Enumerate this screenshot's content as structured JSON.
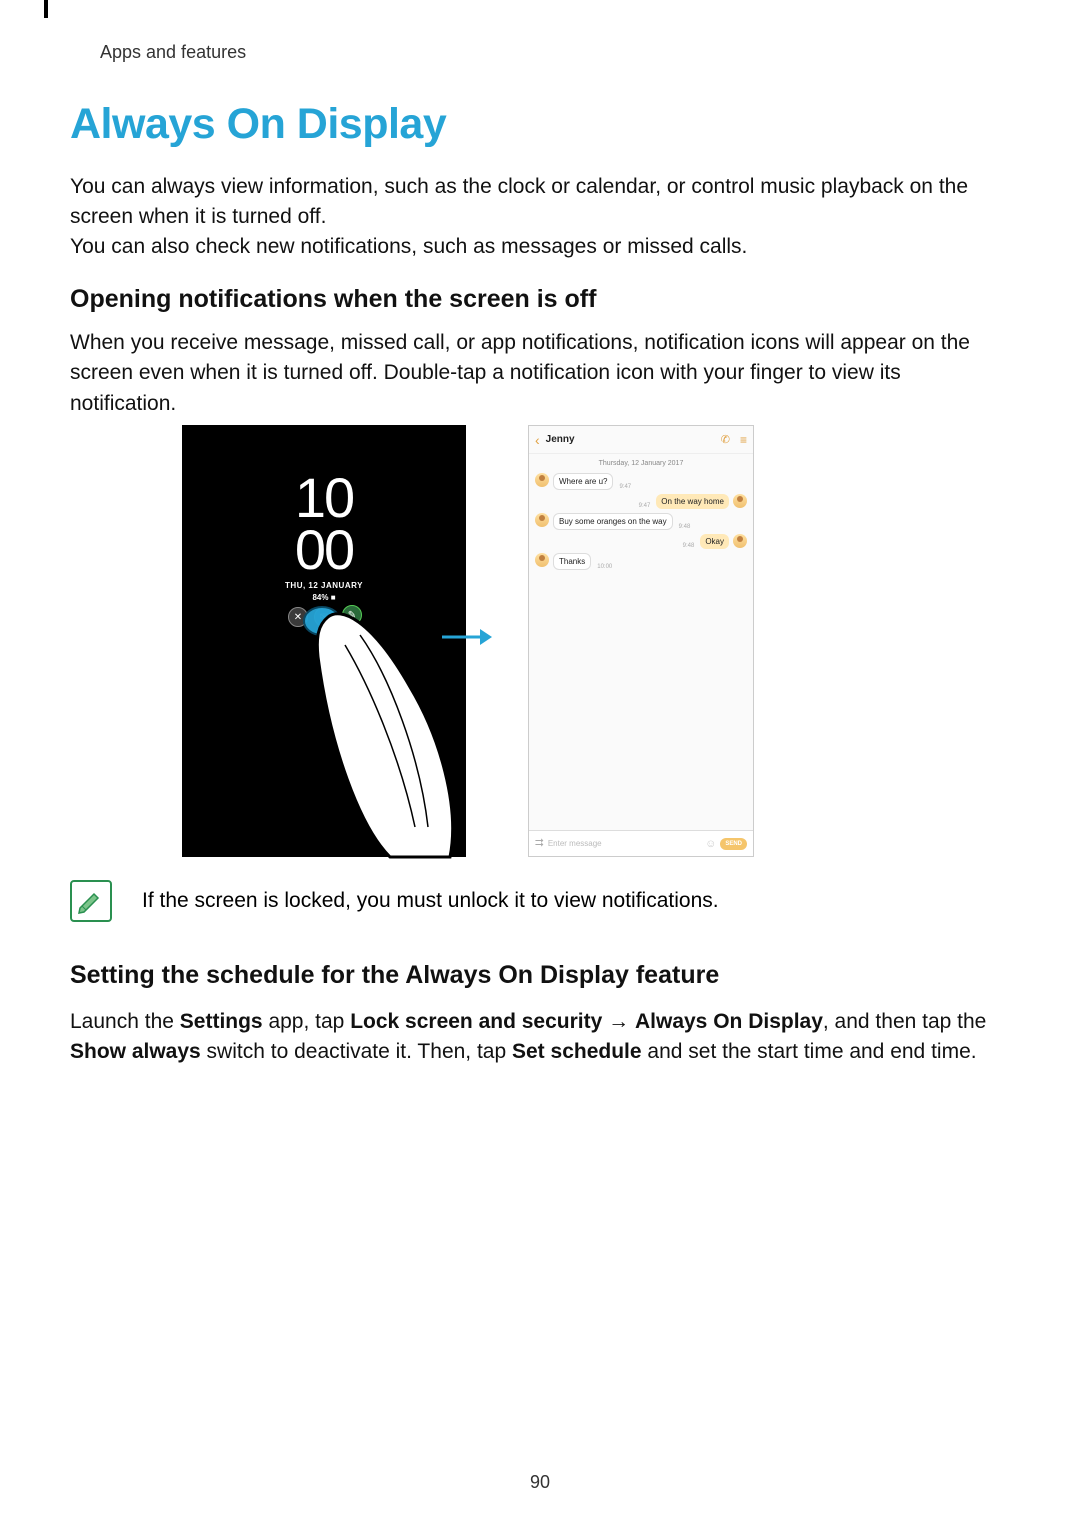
{
  "header": {
    "breadcrumb": "Apps and features"
  },
  "title": "Always On Display",
  "para1": "You can always view information, such as the clock or calendar, or control music playback on the screen when it is turned off.",
  "para2": "You can also check new notifications, such as messages or missed calls.",
  "h2a": "Opening notifications when the screen is off",
  "para3": "When you receive message, missed call, or app notifications, notification icons will appear on the screen even when it is turned off. Double-tap a notification icon with your finger to view its notification.",
  "aod": {
    "hours": "10",
    "minutes": "00",
    "date": "THU, 12 JANUARY",
    "battery": "84% ■"
  },
  "msg": {
    "contact": "Jenny",
    "date_header": "Thursday, 12 January 2017",
    "messages": [
      {
        "dir": "in",
        "text": "Where are u?",
        "time": "9:47"
      },
      {
        "dir": "out",
        "text": "On the way home",
        "time": "9:47"
      },
      {
        "dir": "in",
        "text": "Buy some oranges on the way",
        "time": "9:48"
      },
      {
        "dir": "out",
        "text": "Okay",
        "time": "9:48"
      },
      {
        "dir": "in",
        "text": "Thanks",
        "time": "10:00"
      }
    ],
    "placeholder": "Enter message",
    "send_label": "SEND"
  },
  "note_text": "If the screen is locked, you must unlock it to view notifications.",
  "h2b": "Setting the schedule for the Always On Display feature",
  "para4": {
    "prefix": "Launch the ",
    "b1": "Settings",
    "mid1": " app, tap ",
    "b2": "Lock screen and security",
    "arrow": " → ",
    "b3": "Always On Display",
    "mid2": ", and then tap the ",
    "b4": "Show always",
    "mid3": " switch to deactivate it. Then, tap ",
    "b5": "Set schedule",
    "suffix": " and set the start time and end time."
  },
  "page_number": "90"
}
